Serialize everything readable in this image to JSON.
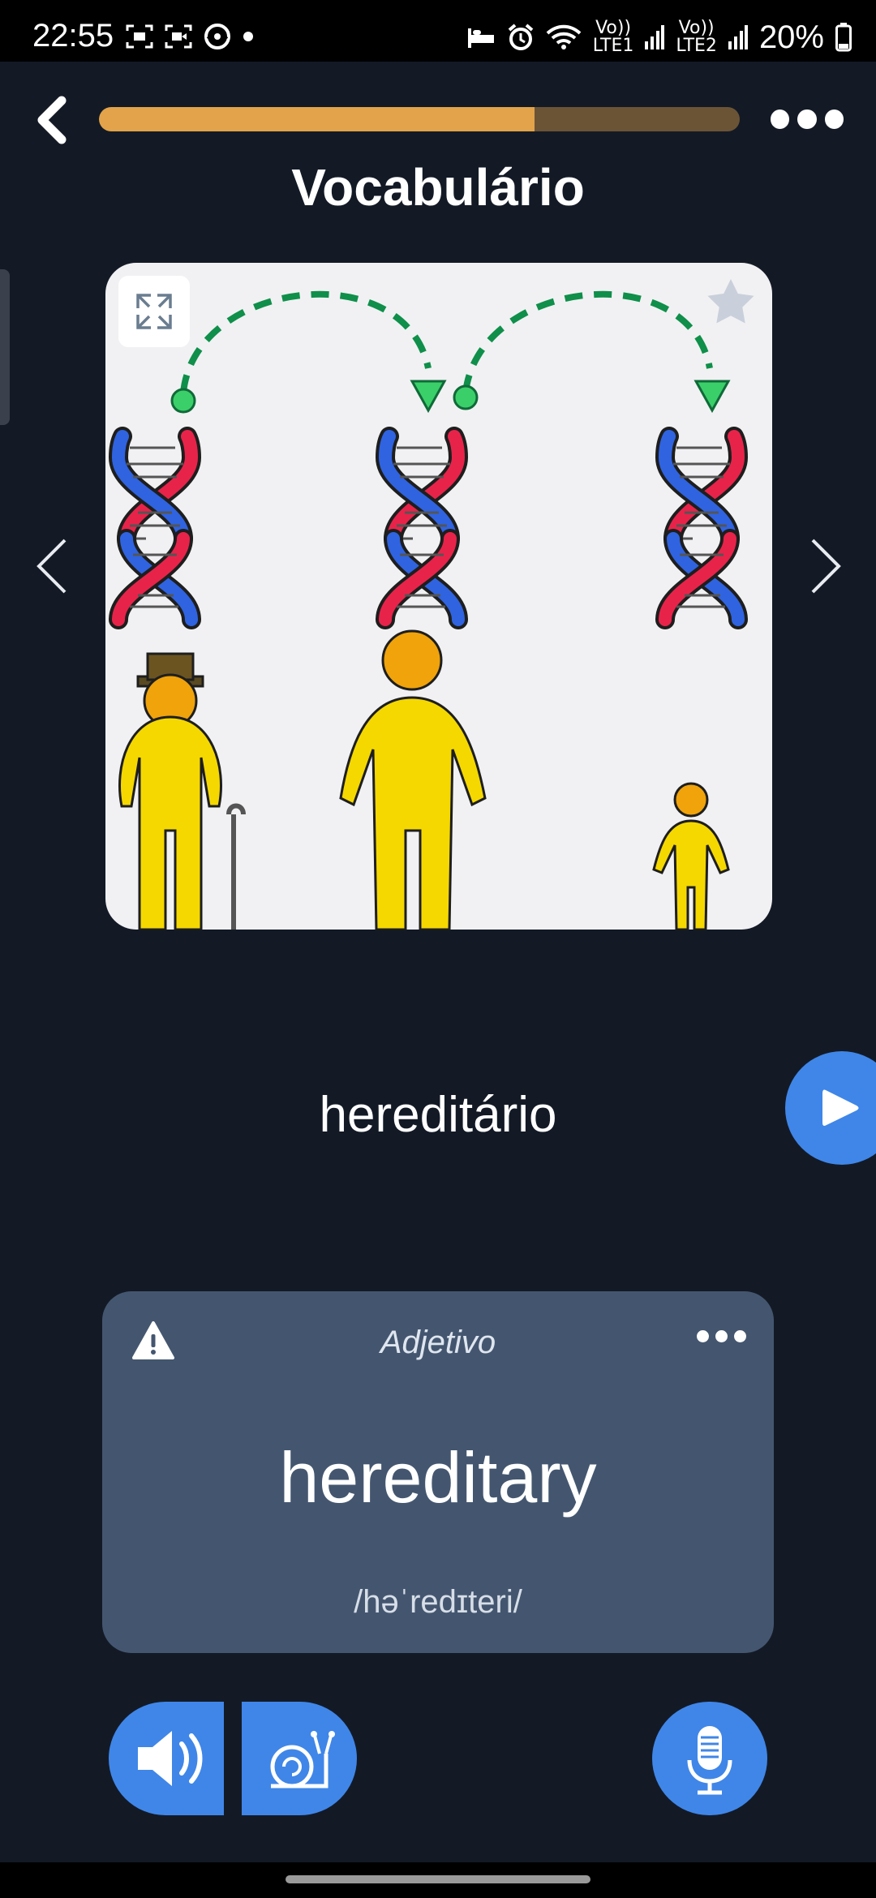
{
  "status_bar": {
    "time": "22:55",
    "left_icons": [
      "screenshot-icon",
      "screen-record-icon",
      "edge-sync-icon",
      "notification-dot-icon"
    ],
    "right_icons": [
      "sleep-mode-icon",
      "alarm-icon",
      "wifi-icon",
      "volte-lte1-icon",
      "signal-1-icon",
      "volte-lte2-icon",
      "signal-2-icon",
      "battery-icon"
    ],
    "lte1_label": "LTE1",
    "lte2_label": "LTE2",
    "volte_label": "Vo))",
    "battery_percent": "20%"
  },
  "header": {
    "title": "Vocabulário",
    "progress_fraction": 0.68,
    "back_icon": "chevron-left-icon",
    "more_icon": "more-horizontal-icon"
  },
  "image_card": {
    "expand_icon": "expand-icon",
    "favorite_icon": "star-icon",
    "illustration": "dna-inheritance-family-illustration"
  },
  "navigation": {
    "prev_icon": "chevron-left-icon",
    "next_icon": "chevron-right-icon"
  },
  "word": {
    "portuguese": "hereditário",
    "play_icon": "play-icon"
  },
  "definition_card": {
    "warning_icon": "warning-icon",
    "part_of_speech": "Adjetivo",
    "english": "hereditary",
    "ipa": "/həˈredɪteri/"
  },
  "actions": {
    "speaker_icon": "speaker-icon",
    "slow_icon": "snail-icon",
    "mic_icon": "microphone-icon"
  },
  "colors": {
    "background": "#131a26",
    "progress_fill": "#e2a34a",
    "progress_track": "#6b5436",
    "accent_blue": "#3f86e8",
    "card": "#44566f"
  }
}
